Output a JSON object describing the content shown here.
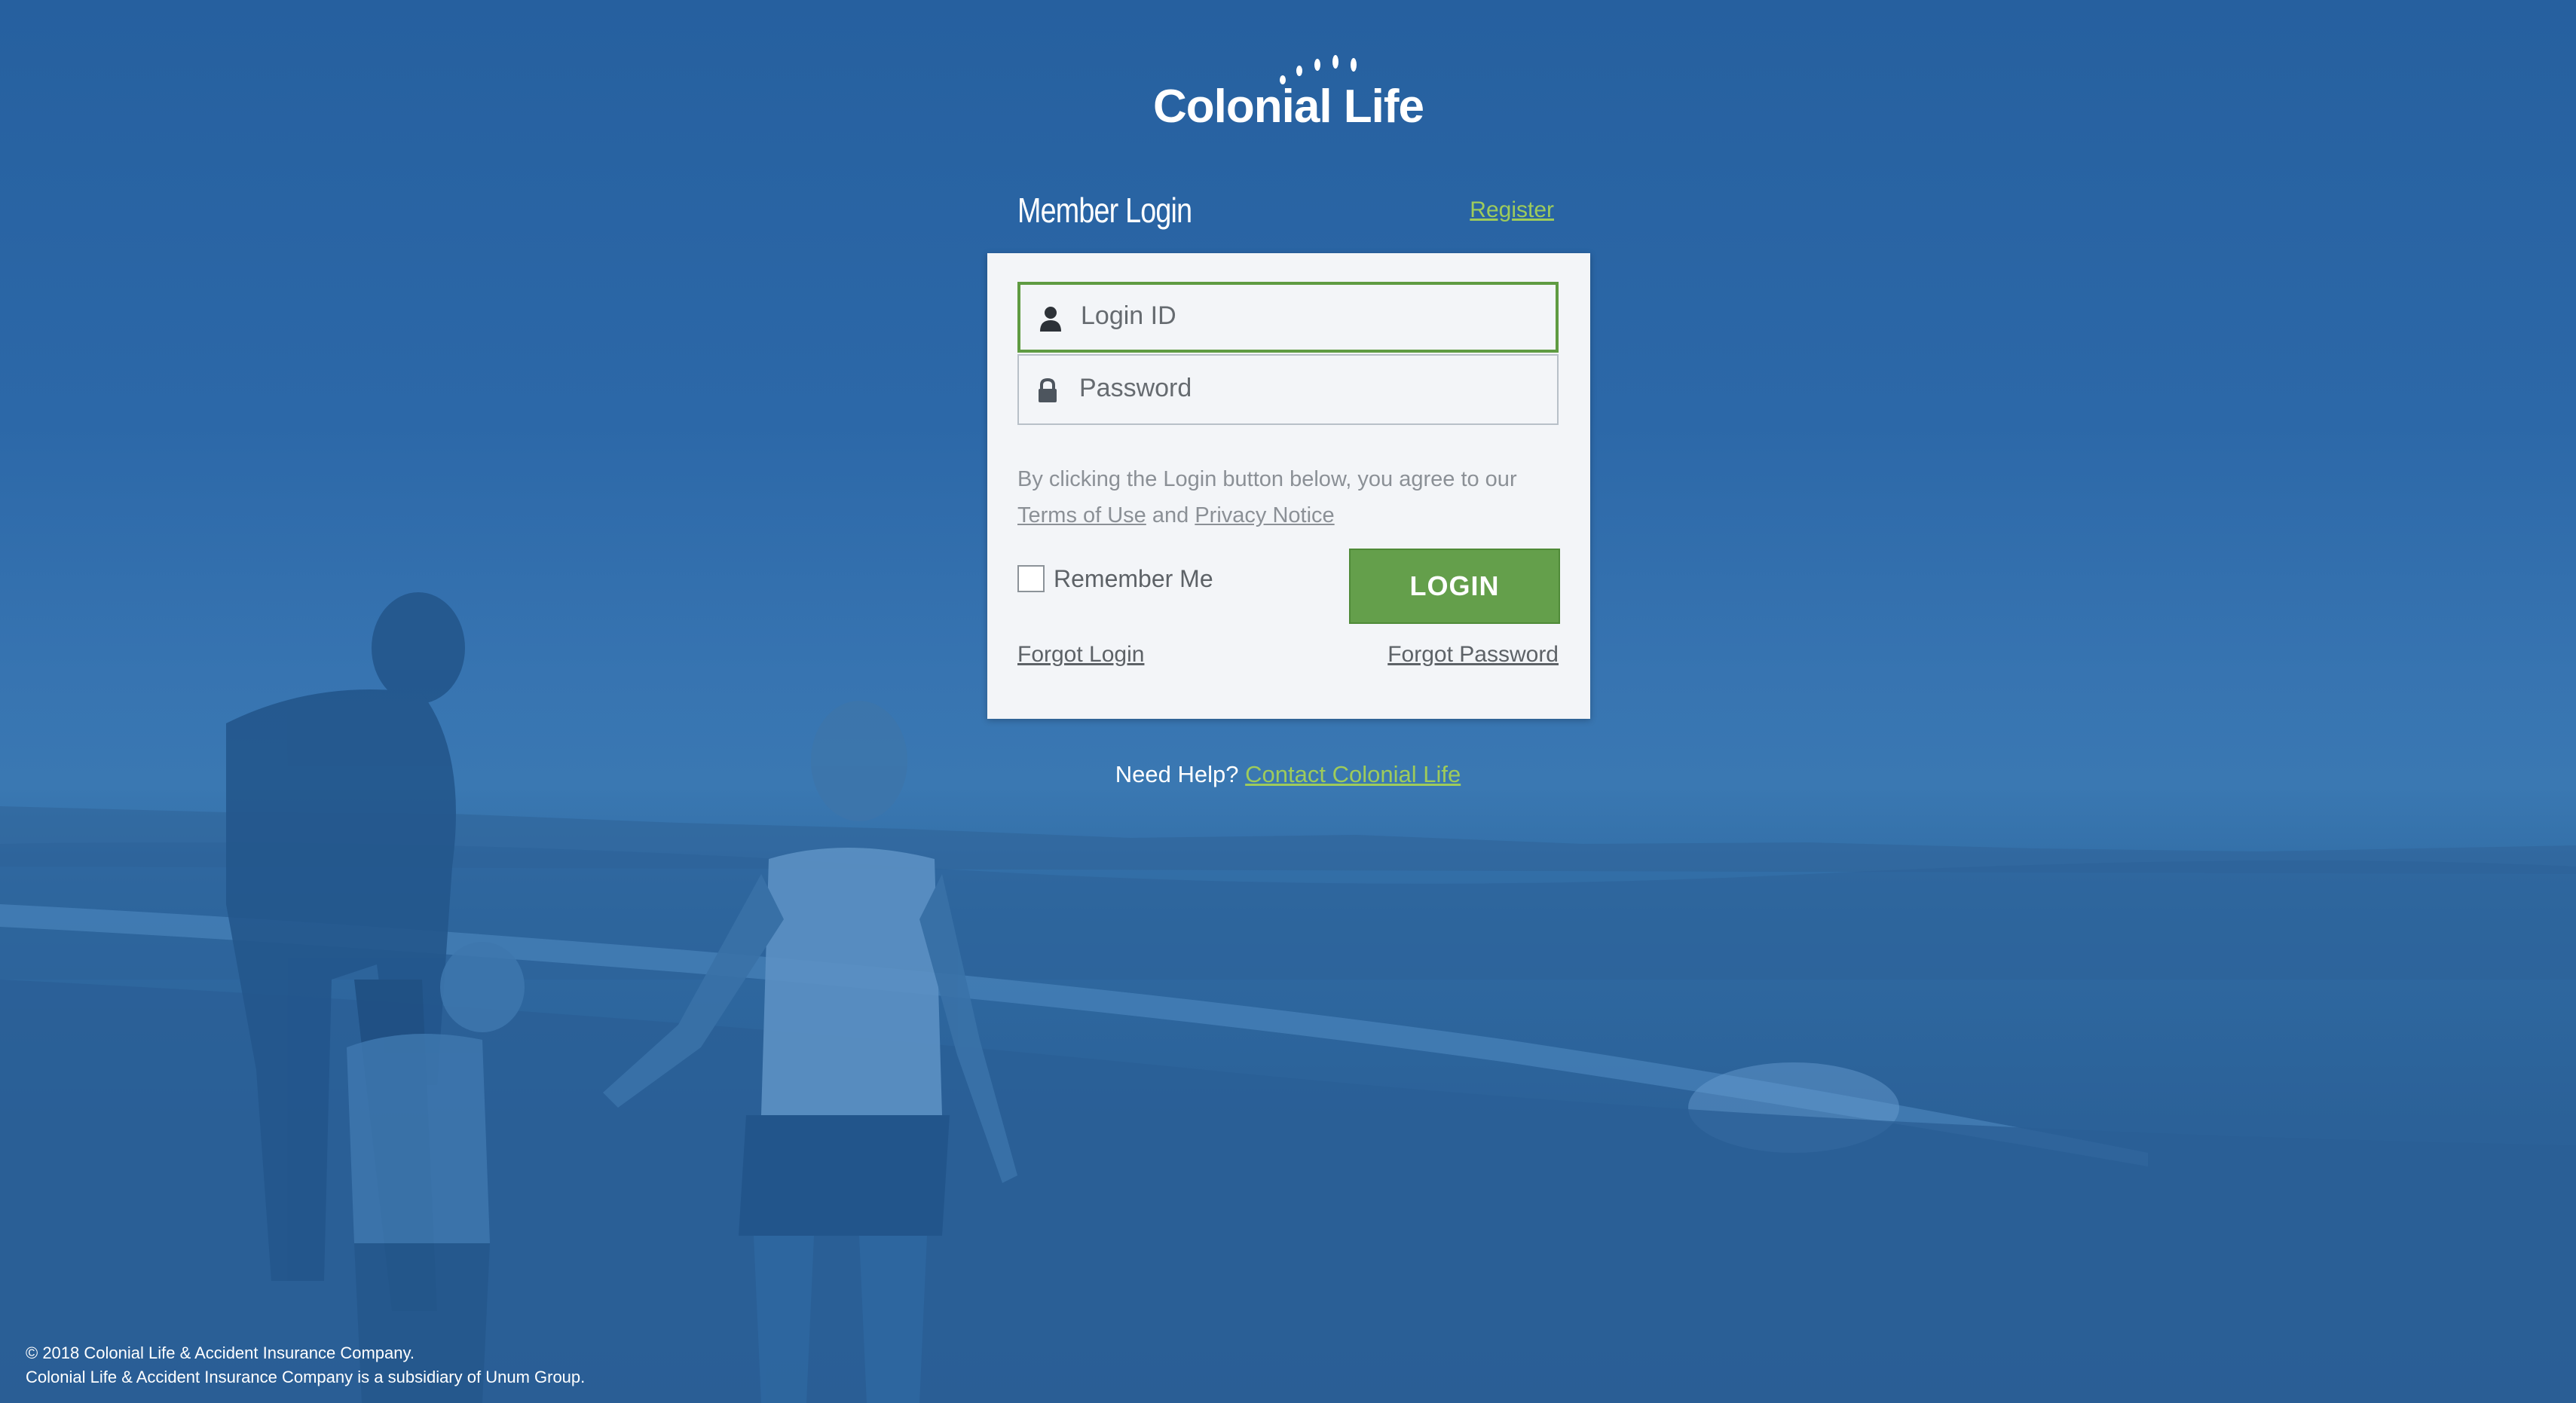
{
  "brand": {
    "logo_text": "Colonial Life",
    "accent_green": "#649f4b",
    "link_green": "#9ecb5b",
    "background_blue": "#2b64a3"
  },
  "header": {
    "title": "Member Login",
    "register_link": "Register"
  },
  "form": {
    "login_id_placeholder": "Login ID",
    "password_placeholder": "Password",
    "login_icon": "user-icon",
    "password_icon": "lock-icon",
    "agreement_text": "By clicking the Login button below, you agree to our",
    "terms_link": "Terms of Use",
    "and_text": "and",
    "privacy_link": "Privacy Notice",
    "remember_label": "Remember Me",
    "remember_checked": false,
    "login_button": "LOGIN",
    "forgot_login": "Forgot Login",
    "forgot_password": "Forgot Password"
  },
  "help": {
    "prompt": "Need Help?",
    "contact_link": "Contact Colonial Life"
  },
  "footer": {
    "copyright": "© 2018 Colonial Life & Accident Insurance Company.",
    "subsidiary": "Colonial Life & Accident Insurance Company is a subsidiary of Unum Group."
  }
}
